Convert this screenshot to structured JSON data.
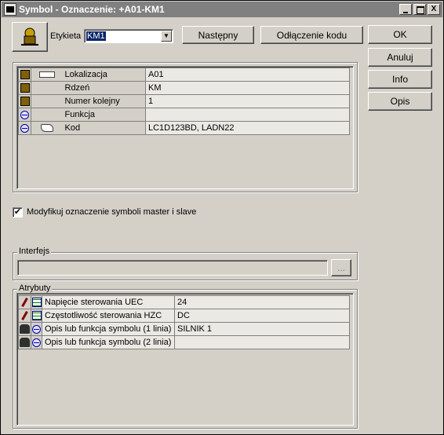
{
  "window": {
    "title": "Symbol - Oznaczenie: +A01-KM1"
  },
  "titlebar_buttons": {
    "minimize": "_",
    "maximize": "□",
    "close": "X"
  },
  "label_field": {
    "label": "Etykieta",
    "value": "KM1"
  },
  "buttons": {
    "next": "Następny",
    "unlink_code": "Odłączenie kodu",
    "ok": "OK",
    "cancel": "Anuluj",
    "info": "Info",
    "description": "Opis",
    "browse": "..."
  },
  "designation": {
    "rows": [
      {
        "icon": "symbol-icon",
        "icon2": "location-icon",
        "label": "Lokalizacja",
        "value": "A01"
      },
      {
        "icon": "symbol-icon",
        "icon2": "",
        "label": "Rdzeń",
        "value": "KM"
      },
      {
        "icon": "symbol-icon",
        "icon2": "",
        "label": "Numer kolejny",
        "value": "1"
      },
      {
        "icon": "globe-icon",
        "icon2": "",
        "label": "Funkcja",
        "value": ""
      },
      {
        "icon": "globe-icon",
        "icon2": "book-icon",
        "label": "Kod",
        "value": "LC1D123BD, LADN22"
      }
    ]
  },
  "modify_checkbox": {
    "label": "Modyfikuj oznaczenie symboli master i slave",
    "checked": "✔"
  },
  "interface_group": {
    "label": "Interfejs",
    "value": ""
  },
  "attributes_group": {
    "label": "Atrybuty",
    "rows": [
      {
        "icon": "pen-icon",
        "icon2": "table-icon",
        "label": "Napięcie sterowania UEC",
        "value": "24"
      },
      {
        "icon": "pen-icon",
        "icon2": "table-icon",
        "label": "Częstotliwość sterowania HZC",
        "value": "DC"
      },
      {
        "icon": "people-icon",
        "icon2": "globe-icon",
        "label": "Opis lub funkcja symbolu (1 linia)",
        "value": "SILNIK 1"
      },
      {
        "icon": "people-icon",
        "icon2": "globe-icon",
        "label": "Opis lub funkcja symbolu (2 linia)",
        "value": ""
      }
    ]
  }
}
